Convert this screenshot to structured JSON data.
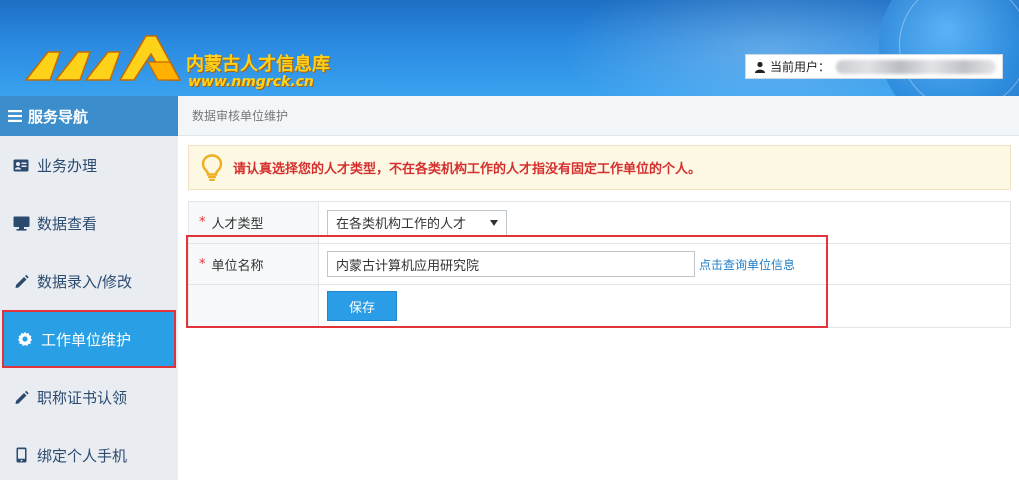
{
  "header": {
    "logo_cn": "内蒙古人才信息库",
    "logo_url": "www.nmgrck.cn",
    "user_label": "当前用户："
  },
  "sidebar": {
    "title": "服务导航",
    "items": [
      {
        "label": "业务办理",
        "icon": "id-card-icon"
      },
      {
        "label": "数据查看",
        "icon": "monitor-icon"
      },
      {
        "label": "数据录入/修改",
        "icon": "pencil-icon"
      },
      {
        "label": "工作单位维护",
        "icon": "gear-icon",
        "active": true
      },
      {
        "label": "职称证书认领",
        "icon": "pencil-icon"
      },
      {
        "label": "绑定个人手机",
        "icon": "mobile-icon"
      }
    ]
  },
  "breadcrumb": "数据审核单位维护",
  "notice": "请认真选择您的人才类型，不在各类机构工作的人才指没有固定工作单位的个人。",
  "form": {
    "talent_type_label": "人才类型",
    "talent_type_value": "在各类机构工作的人才",
    "unit_name_label": "单位名称",
    "unit_name_value": "内蒙古计算机应用研究院",
    "query_link": "点击查询单位信息",
    "save_label": "保存"
  },
  "colors": {
    "accent": "#29a0e6",
    "highlight": "#e0333a",
    "notice_text": "#d62f2f"
  }
}
